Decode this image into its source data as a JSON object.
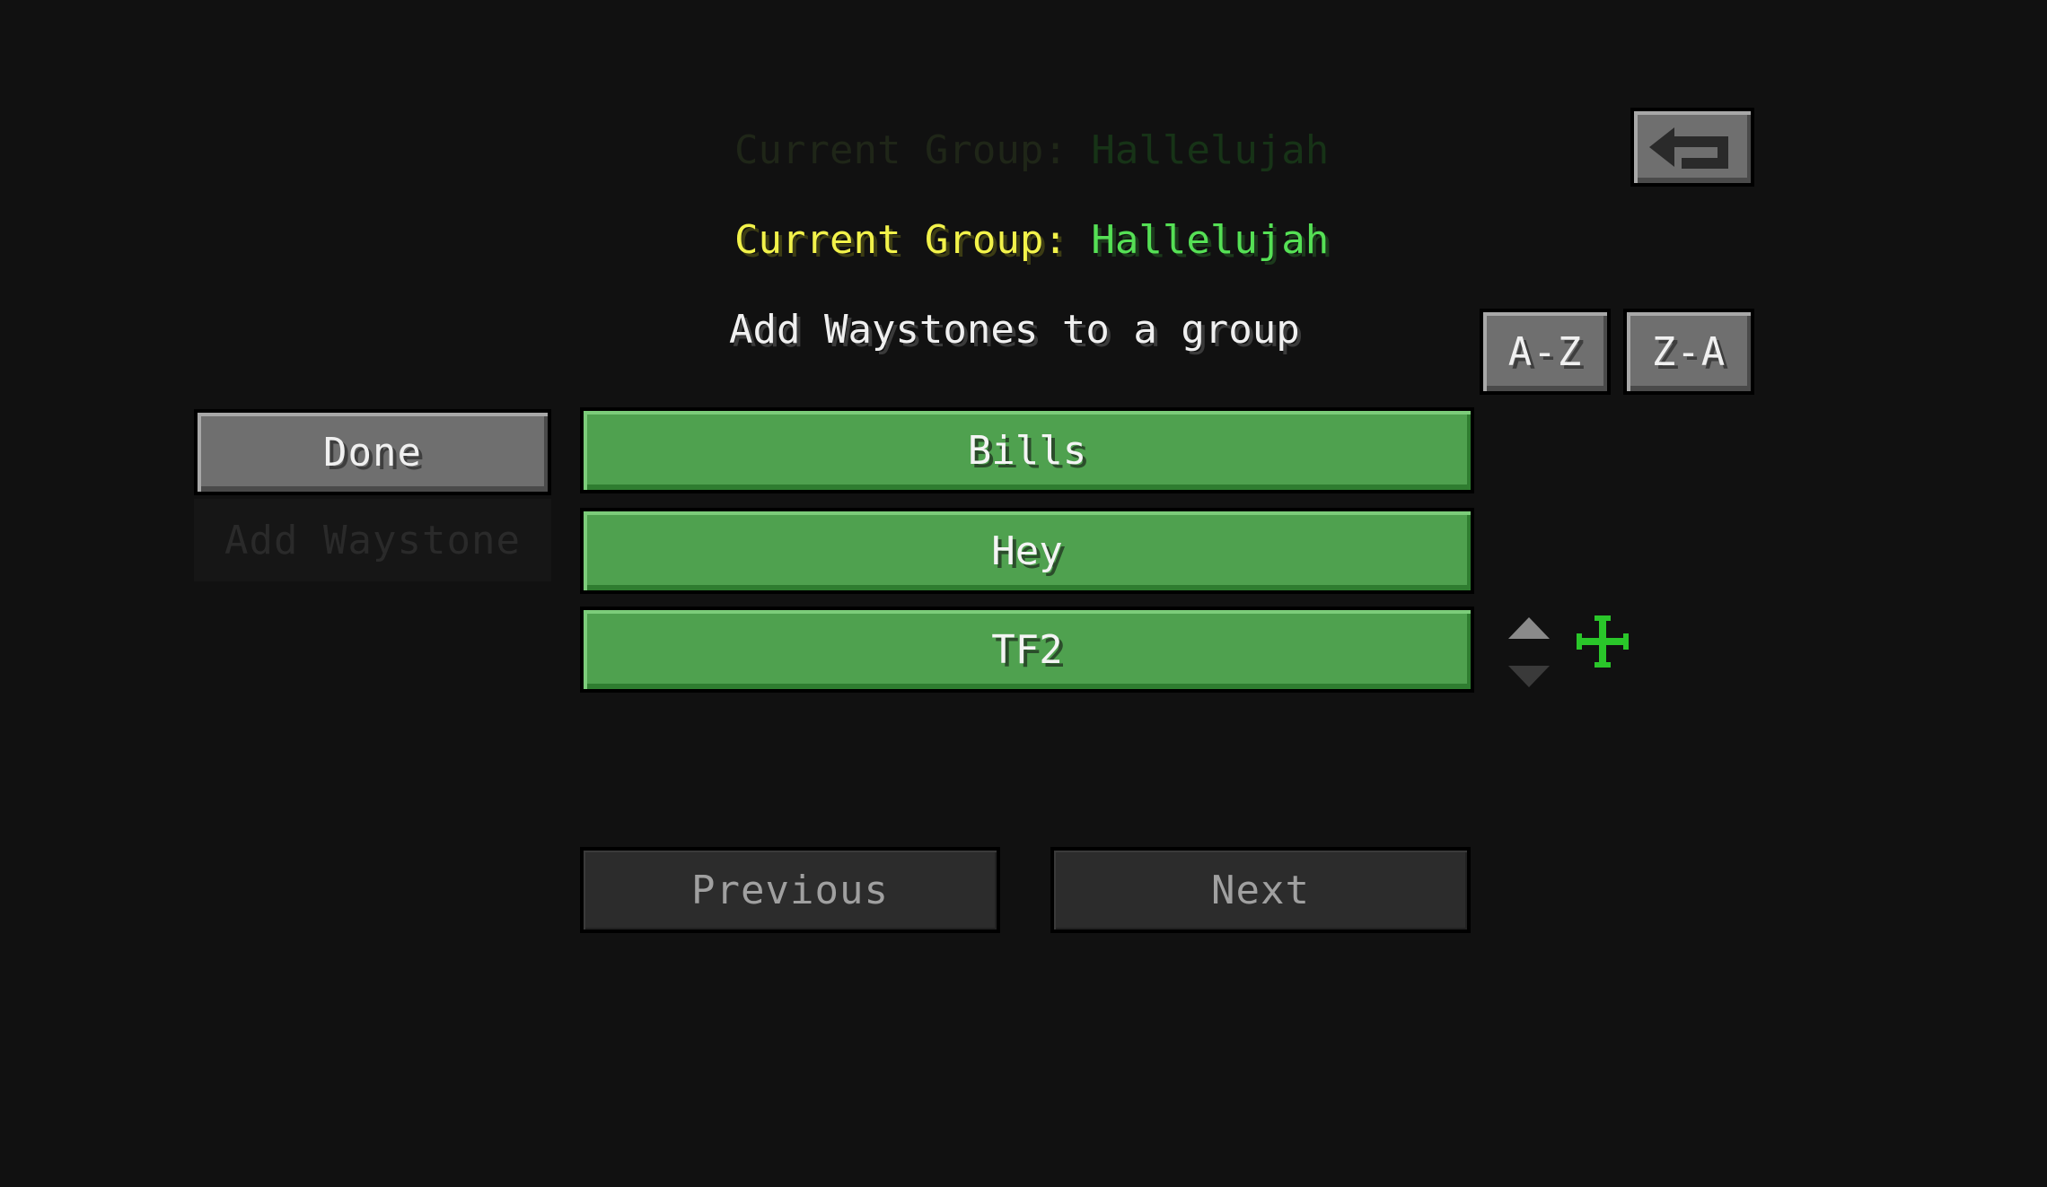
{
  "ghost_header": {
    "label": "Current Group:",
    "value": "Hallelujah"
  },
  "header": {
    "label": "Current Group:",
    "value": "Hallelujah"
  },
  "subtitle": "Add Waystones to a group",
  "sort_buttons": {
    "az": "A-Z",
    "za": "Z-A"
  },
  "back_button": {
    "icon": "back-arrow-icon"
  },
  "sidebar": {
    "done": "Done",
    "add_waystone": "Add Waystone"
  },
  "groups": [
    {
      "label": "Bills"
    },
    {
      "label": "Hey"
    },
    {
      "label": "TF2"
    }
  ],
  "pagination": {
    "previous": "Previous",
    "next": "Next"
  },
  "colors": {
    "background": "#111111",
    "label_yellow": "#f2f24a",
    "value_green": "#55e055",
    "row_green": "#4fa14f",
    "crosshair_green": "#2ac62a"
  }
}
